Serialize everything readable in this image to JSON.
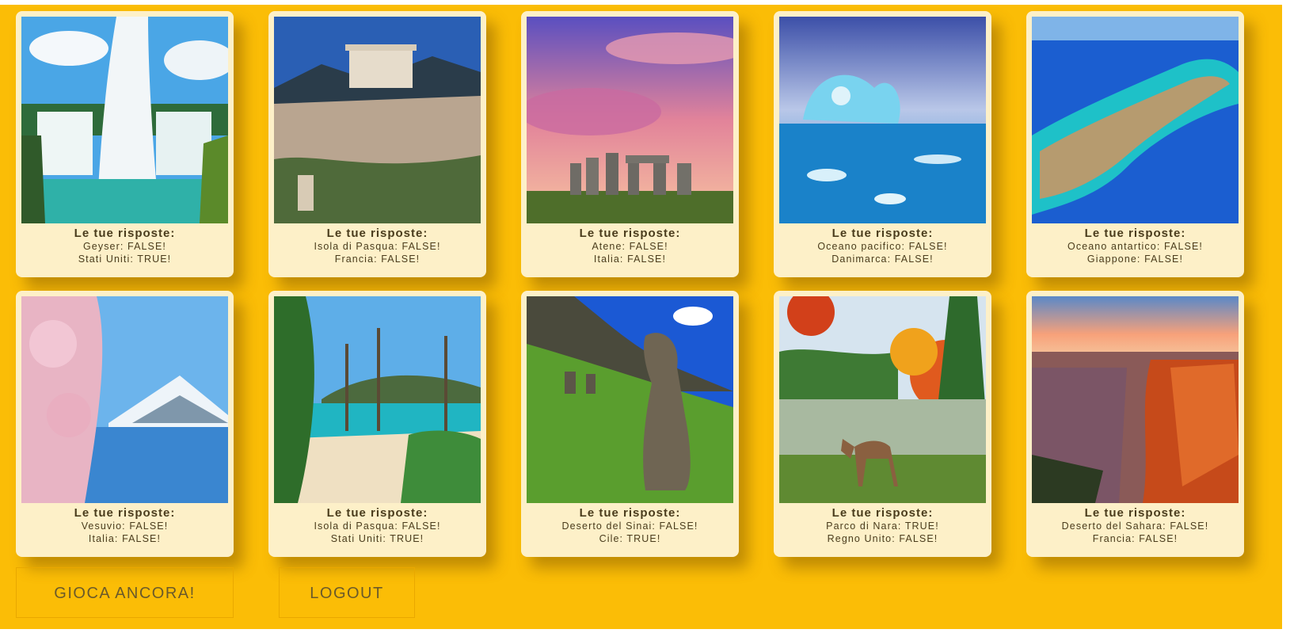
{
  "cards": [
    {
      "title": "Le tue risposte:",
      "line1": "Geyser: FALSE!",
      "line2": "Stati Uniti: TRUE!",
      "image": "niagara-falls-photo"
    },
    {
      "title": "Le tue risposte:",
      "line1": "Isola di Pasqua: FALSE!",
      "line2": "Francia: FALSE!",
      "image": "acropolis-photo"
    },
    {
      "title": "Le tue risposte:",
      "line1": "Atene: FALSE!",
      "line2": "Italia: FALSE!",
      "image": "stonehenge-photo"
    },
    {
      "title": "Le tue risposte:",
      "line1": "Oceano pacifico: FALSE!",
      "line2": "Danimarca: FALSE!",
      "image": "iceberg-photo"
    },
    {
      "title": "Le tue risposte:",
      "line1": "Oceano antartico: FALSE!",
      "line2": "Giappone: FALSE!",
      "image": "great-barrier-reef-photo"
    },
    {
      "title": "Le tue risposte:",
      "line1": "Vesuvio: FALSE!",
      "line2": "Italia: FALSE!",
      "image": "mount-fuji-photo"
    },
    {
      "title": "Le tue risposte:",
      "line1": "Isola di Pasqua: FALSE!",
      "line2": "Stati Uniti: TRUE!",
      "image": "hawaii-beach-photo"
    },
    {
      "title": "Le tue risposte:",
      "line1": "Deserto del Sinai: FALSE!",
      "line2": "Cile: TRUE!",
      "image": "easter-island-moai-photo"
    },
    {
      "title": "Le tue risposte:",
      "line1": "Parco di Nara: TRUE!",
      "line2": "Regno Unito: FALSE!",
      "image": "autumn-deer-park-photo"
    },
    {
      "title": "Le tue risposte:",
      "line1": "Deserto del Sahara: FALSE!",
      "line2": "Francia: FALSE!",
      "image": "grand-canyon-photo"
    }
  ],
  "buttons": {
    "play_again": "GIOCA ANCORA!",
    "logout": "LOGOUT"
  },
  "colors": {
    "background": "#fbbd06",
    "card": "#fdf0c8",
    "text": "#4a3c1c"
  }
}
